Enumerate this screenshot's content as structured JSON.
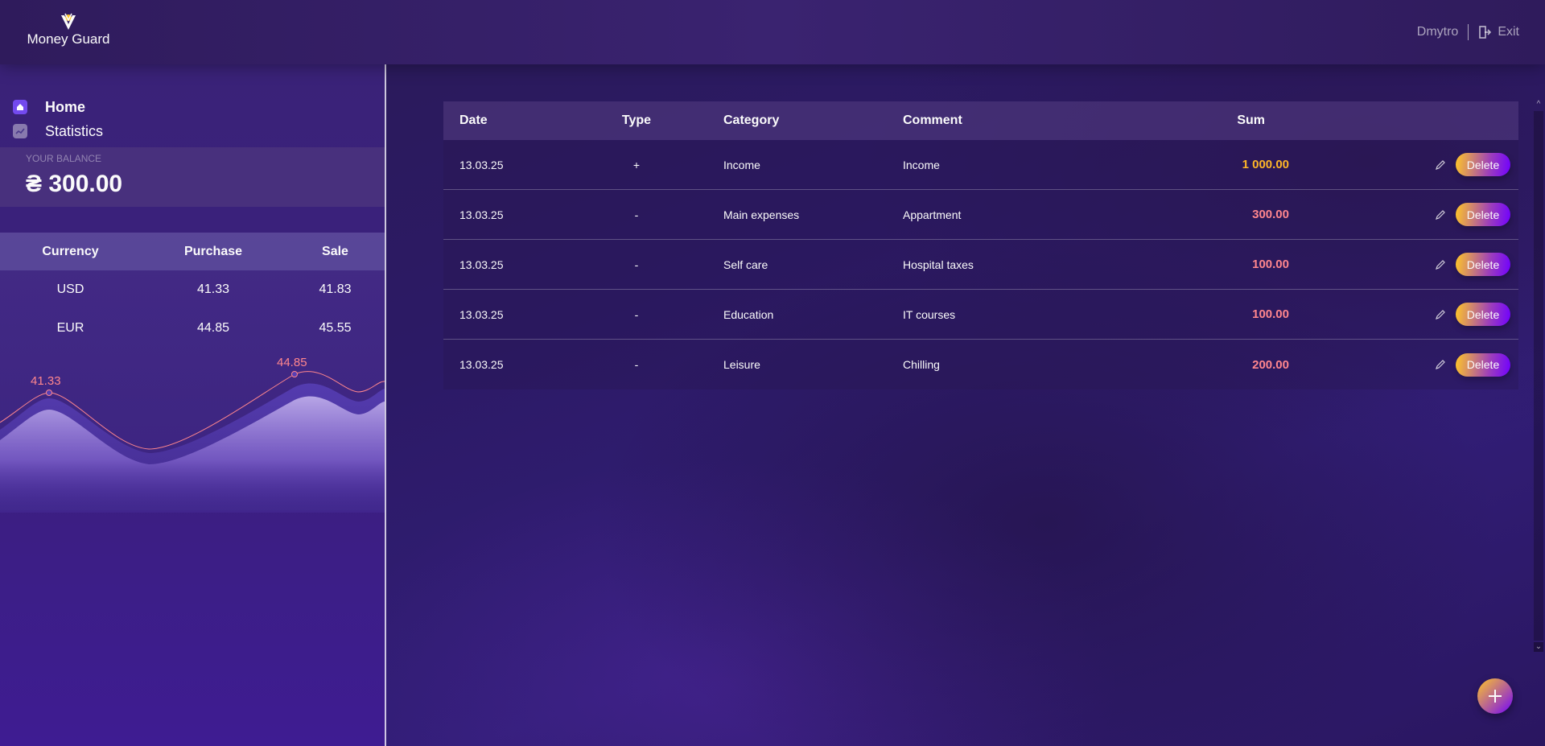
{
  "app": {
    "logo_text": "Money Guard"
  },
  "header": {
    "username": "Dmytro",
    "exit_label": "Exit"
  },
  "nav": {
    "items": [
      {
        "label": "Home",
        "icon": "home-icon",
        "active": true
      },
      {
        "label": "Statistics",
        "icon": "statistics-icon",
        "active": false
      }
    ]
  },
  "balance": {
    "caption": "Your balance",
    "value": "₴ 300.00"
  },
  "currency": {
    "headers": {
      "currency": "Currency",
      "purchase": "Purchase",
      "sale": "Sale"
    },
    "rows": [
      {
        "currency": "USD",
        "purchase": "41.33",
        "sale": "41.83"
      },
      {
        "currency": "EUR",
        "purchase": "44.85",
        "sale": "45.55"
      }
    ],
    "chart_labels": {
      "usd": "41.33",
      "eur": "44.85"
    }
  },
  "transactions": {
    "headers": {
      "date": "Date",
      "type": "Type",
      "category": "Category",
      "comment": "Comment",
      "sum": "Sum"
    },
    "delete_label": "Delete",
    "rows": [
      {
        "date": "13.03.25",
        "type": "+",
        "category": "Income",
        "comment": "Income",
        "sum": "1 000.00",
        "kind": "income"
      },
      {
        "date": "13.03.25",
        "type": "-",
        "category": "Main expenses",
        "comment": "Appartment",
        "sum": "300.00",
        "kind": "expense"
      },
      {
        "date": "13.03.25",
        "type": "-",
        "category": "Self care",
        "comment": "Hospital taxes",
        "sum": "100.00",
        "kind": "expense"
      },
      {
        "date": "13.03.25",
        "type": "-",
        "category": "Education",
        "comment": "IT courses",
        "sum": "100.00",
        "kind": "expense"
      },
      {
        "date": "13.03.25",
        "type": "-",
        "category": "Leisure",
        "comment": "Chilling",
        "sum": "200.00",
        "kind": "expense"
      }
    ]
  },
  "colors": {
    "income": "#ffb627",
    "expense": "#ff868d",
    "accent": "#734aef"
  }
}
